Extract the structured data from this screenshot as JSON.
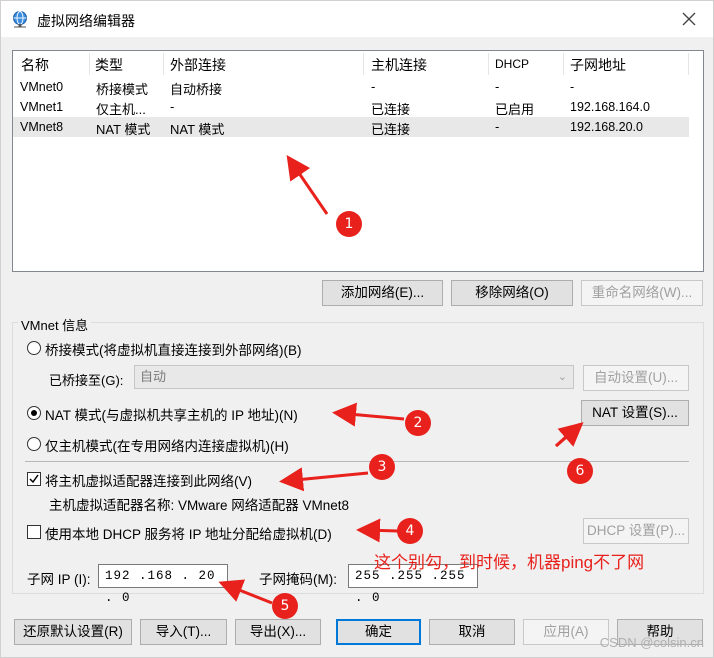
{
  "window": {
    "title": "虚拟网络编辑器"
  },
  "list": {
    "headers": [
      "名称",
      "类型",
      "外部连接",
      "主机连接",
      "DHCP",
      "子网地址"
    ],
    "rows": [
      [
        "VMnet0",
        "桥接模式",
        "自动桥接",
        "-",
        "-",
        "-"
      ],
      [
        "VMnet1",
        "仅主机...",
        "-",
        "已连接",
        "已启用",
        "192.168.164.0"
      ],
      [
        "VMnet8",
        "NAT 模式",
        "NAT 模式",
        "已连接",
        "-",
        "192.168.20.0"
      ]
    ]
  },
  "list_buttons": {
    "add": "添加网络(E)...",
    "remove": "移除网络(O)",
    "rename": "重命名网络(W)..."
  },
  "vmnet_info": {
    "group_label": "VMnet 信息",
    "bridged_radio": "桥接模式(将虚拟机直接连接到外部网络)(B)",
    "bridged_to_label": "已桥接至(G):",
    "bridged_to_value": "自动",
    "auto_settings": "自动设置(U)...",
    "nat_radio": "NAT 模式(与虚拟机共享主机的 IP 地址)(N)",
    "nat_settings": "NAT 设置(S)...",
    "hostonly_radio": "仅主机模式(在专用网络内连接虚拟机)(H)",
    "connect_adapter_checkbox": "将主机虚拟适配器连接到此网络(V)",
    "adapter_name_text": "主机虚拟适配器名称: VMware 网络适配器 VMnet8",
    "dhcp_checkbox": "使用本地 DHCP 服务将 IP 地址分配给虚拟机(D)",
    "dhcp_settings": "DHCP 设置(P)...",
    "subnet_ip_label": "子网 IP (I):",
    "subnet_ip_value": "192 .168 . 20  .  0",
    "subnet_mask_label": "子网掩码(M):",
    "subnet_mask_value": "255 .255 .255 .  0"
  },
  "bottom_buttons": {
    "restore": "还原默认设置(R)",
    "import": "导入(T)...",
    "export": "导出(X)...",
    "ok": "确定",
    "cancel": "取消",
    "apply": "应用(A)",
    "help": "帮助"
  },
  "annotations": {
    "n1": "1",
    "n2": "2",
    "n3": "3",
    "n4": "4",
    "n5": "5",
    "n6": "6",
    "note": "这个别勾，到时候，机器ping不了网",
    "color": "#e8211c"
  },
  "watermark": "CSDN @colsin.cn",
  "state": {
    "selected_row": "VMnet8",
    "selected_mode": "nat",
    "connect_adapter_checked": true,
    "dhcp_checked": false
  }
}
